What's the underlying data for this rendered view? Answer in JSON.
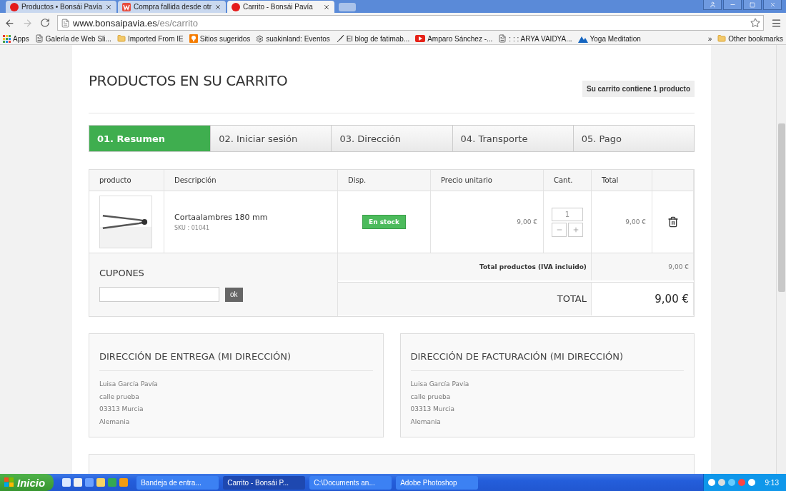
{
  "browser": {
    "tabs": [
      {
        "title": "Productos • Bonsái Pavía",
        "kind": "dot",
        "selected": false
      },
      {
        "title": "Compra fallida desde otr",
        "kind": "w",
        "selected": false
      },
      {
        "title": "Carrito - Bonsái Pavía",
        "kind": "dot",
        "selected": true
      }
    ],
    "url": {
      "host": "www.bonsaipavia.es",
      "path": "/es/carrito"
    },
    "bookmarks": [
      {
        "label": "Apps",
        "kind": "apps"
      },
      {
        "label": "Galería de Web Sli...",
        "kind": "page"
      },
      {
        "label": "Imported From IE",
        "kind": "folder"
      },
      {
        "label": "Sitios sugeridos",
        "kind": "bulb"
      },
      {
        "label": "suakinland: Eventos",
        "kind": "gear"
      },
      {
        "label": "El blog de fatimab...",
        "kind": "feather"
      },
      {
        "label": "Amparo Sánchez -...",
        "kind": "video"
      },
      {
        "label": ": : : ARYA VAIDYA...",
        "kind": "page"
      },
      {
        "label": "Yoga Meditation",
        "kind": "mountains"
      }
    ],
    "more": "»",
    "other_bookmarks": "Other bookmarks"
  },
  "page": {
    "title": "PRODUCTOS EN SU CARRITO",
    "cart_summary": "Su carrito contiene 1 producto",
    "steps": [
      {
        "label": "01. Resumen",
        "selected": true
      },
      {
        "label": "02. Iniciar sesión",
        "selected": false
      },
      {
        "label": "03. Dirección",
        "selected": false
      },
      {
        "label": "04. Transporte",
        "selected": false
      },
      {
        "label": "05. Pago",
        "selected": false
      }
    ],
    "table": {
      "columns": [
        "producto",
        "Descripción",
        "Disp.",
        "Precio unitario",
        "Cant.",
        "Total"
      ],
      "rows": [
        {
          "description": "Cortaalambres 180 mm",
          "sku": "SKU : 01041",
          "availability": "En stock",
          "unit_price": "9,00 €",
          "quantity": "1",
          "total": "9,00 €"
        }
      ]
    },
    "coupons": {
      "title": "CUPONES",
      "button": "ok"
    },
    "subtotal": {
      "label": "Total productos (IVA incluido)",
      "value": "9,00 €"
    },
    "total": {
      "label": "TOTAL",
      "value": "9,00 €"
    },
    "addresses": [
      {
        "title": "DIRECCIÓN DE ENTREGA (MI DIRECCIÓN)",
        "lines": [
          "Luisa García Pavía",
          "calle prueba",
          "03313 Murcia",
          "Alemania"
        ]
      },
      {
        "title": "DIRECCIÓN DE FACTURACIÓN (MI DIRECCIÓN)",
        "lines": [
          "Luisa García Pavía",
          "calle prueba",
          "03313 Murcia",
          "Alemania"
        ]
      }
    ]
  },
  "taskbar": {
    "start": "Inicio",
    "tasks": [
      {
        "label": "Bandeja de entra...",
        "selected": false
      },
      {
        "label": "Carrito - Bonsái P...",
        "selected": true
      },
      {
        "label": "C:\\Documents an...",
        "selected": false
      },
      {
        "label": "Adobe Photoshop",
        "selected": false
      }
    ],
    "clock": "9:13"
  }
}
